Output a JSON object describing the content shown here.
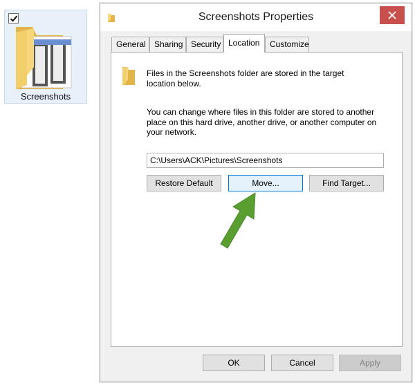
{
  "desktop": {
    "folder_label": "Screenshots",
    "icon": "folder-icon",
    "checked": true
  },
  "window": {
    "title": "Screenshots Properties",
    "close_icon": "close-icon"
  },
  "tabs": [
    {
      "label": "General"
    },
    {
      "label": "Sharing"
    },
    {
      "label": "Security"
    },
    {
      "label": "Location",
      "active": true
    },
    {
      "label": "Customize"
    }
  ],
  "location": {
    "info_line1": "Files in the Screenshots folder are stored in the target",
    "info_line2": "location below.",
    "change_line1": "You can change where files in this folder are stored to another",
    "change_line2": "place on this hard drive, another drive, or another computer on",
    "change_line3": "your network.",
    "path_value": "C:\\Users\\ACK\\Pictures\\Screenshots",
    "restore_default_label": "Restore Default",
    "move_label": "Move...",
    "find_target_label": "Find Target..."
  },
  "footer": {
    "ok_label": "OK",
    "cancel_label": "Cancel",
    "apply_label": "Apply"
  },
  "colors": {
    "close_button": "#c7504c",
    "arrow": "#5a9e32",
    "folder": "#f3cf6b"
  }
}
